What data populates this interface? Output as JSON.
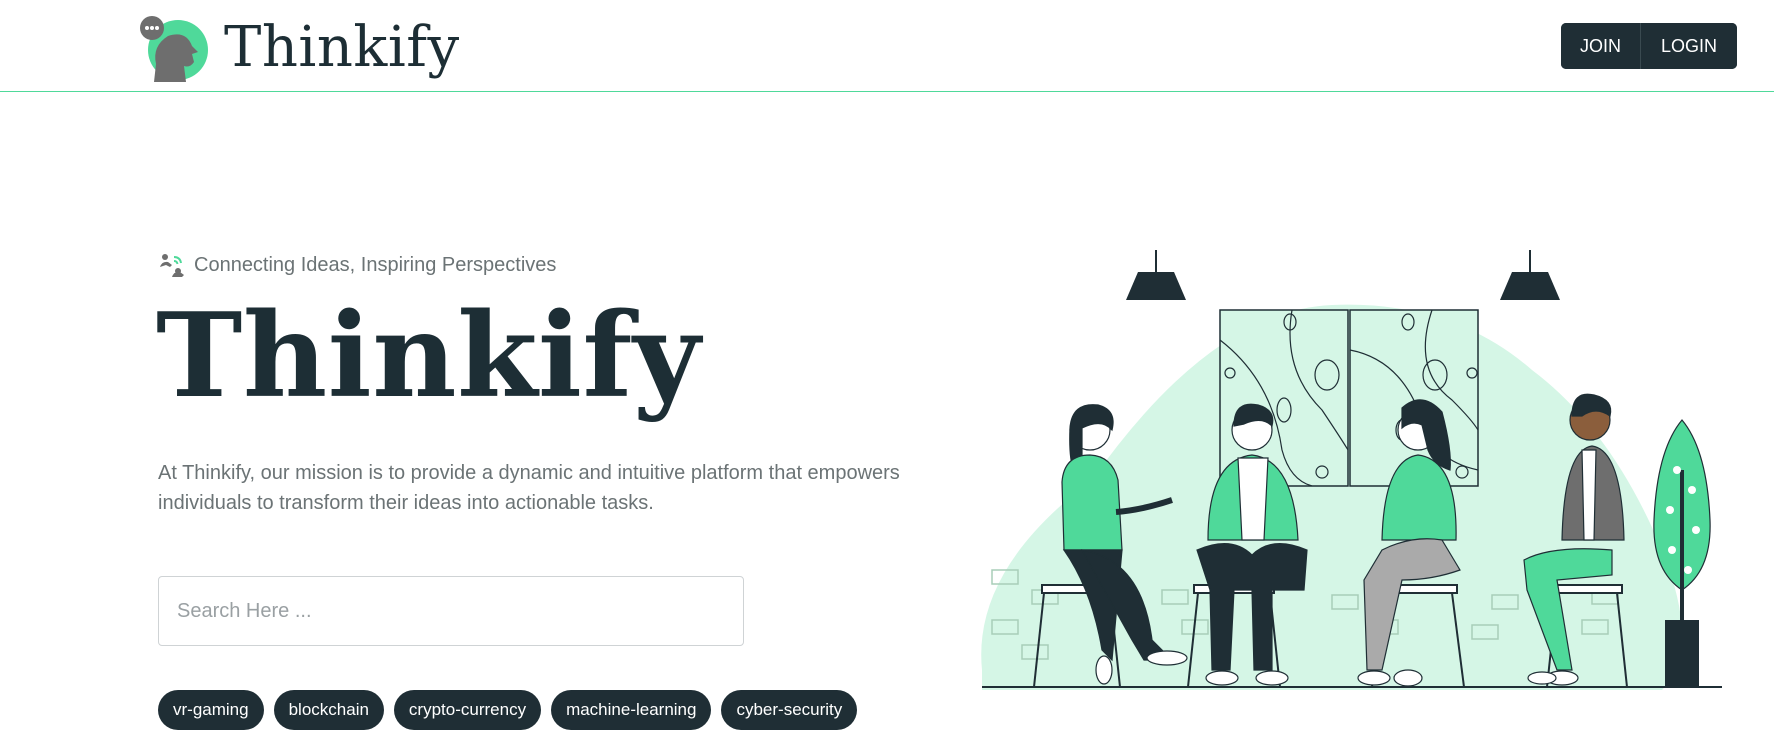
{
  "brand": {
    "name": "Thinkify",
    "logo_icon": "speech-bubble-head-icon"
  },
  "auth": {
    "join_label": "JOIN",
    "login_label": "LOGIN"
  },
  "hero": {
    "tagline": "Connecting Ideas, Inspiring Perspectives",
    "tagline_icon": "connect-people-icon",
    "title": "Thinkify",
    "mission": "At Thinkify, our mission is to provide a dynamic and intuitive platform that empowers individuals to transform their ideas into actionable tasks.",
    "search_placeholder": "Search Here ...",
    "search_value": "",
    "tags": [
      "vr-gaming",
      "blockchain",
      "crypto-currency",
      "machine-learning",
      "cyber-security"
    ],
    "illustration": "people-discussion-illustration"
  },
  "colors": {
    "accent": "#4fd99a",
    "accent_light": "#d5f6e6",
    "dark": "#1f2e35",
    "muted_text": "#6b7375"
  }
}
